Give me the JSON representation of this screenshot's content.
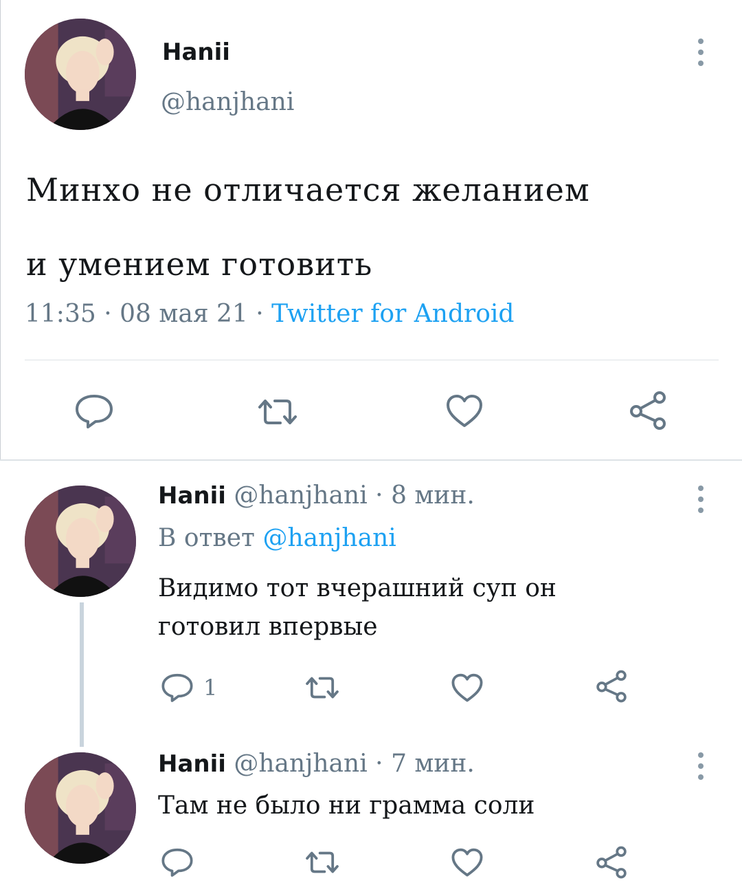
{
  "main_tweet": {
    "author_name": "Hanii",
    "author_handle": "@hanjhani",
    "text_line1": "Минхо не отличается желанием",
    "text_line2": "и умением готовить",
    "time": "11:35",
    "date": "08 мая 21",
    "separator": "·",
    "source": "Twitter for Android",
    "actions": [
      "reply-icon",
      "retweet-icon",
      "like-icon",
      "share-icon"
    ]
  },
  "replies": [
    {
      "author_name": "Hanii",
      "author_handle": "@hanjhani",
      "time_ago": "8 мин.",
      "reply_to_label": "В ответ",
      "reply_to_handle": "@hanjhani",
      "text_line1": "Видимо тот вчерашний суп он",
      "text_line2": "готовил впервые",
      "reply_count": "1"
    },
    {
      "author_name": "Hanii",
      "author_handle": "@hanjhani",
      "time_ago": "7 мин.",
      "text_line1": "Там не было ни грамма соли",
      "reply_count": ""
    }
  ],
  "colors": {
    "link": "#1da1f2",
    "secondary_text": "#657786",
    "icon": "#657786",
    "divider": "#dde2e6"
  }
}
